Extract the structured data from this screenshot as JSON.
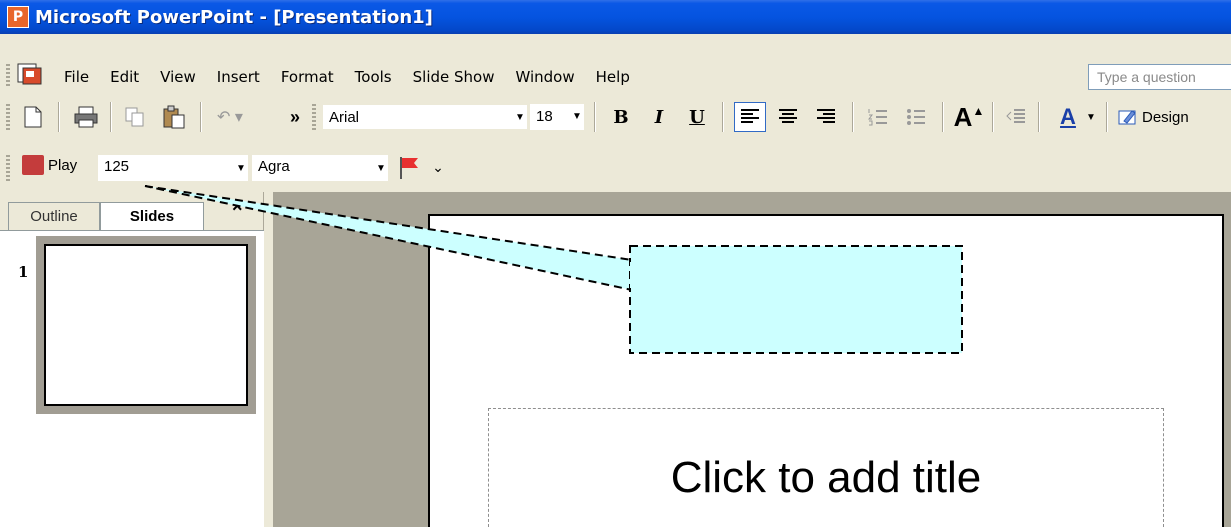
{
  "window": {
    "title": "Microsoft PowerPoint - [Presentation1]"
  },
  "menu": {
    "items": [
      "File",
      "Edit",
      "View",
      "Insert",
      "Format",
      "Tools",
      "Slide Show",
      "Window",
      "Help"
    ],
    "help_placeholder": "Type a question"
  },
  "formatting": {
    "font": "Arial",
    "size": "18",
    "bold": "B",
    "italic": "I",
    "underline": "U",
    "grow_font": "A",
    "font_color": "A",
    "design": "Design",
    "more": "»"
  },
  "narration": {
    "play_label": "Play",
    "value": "125",
    "voice": "Agra"
  },
  "pane": {
    "tab_outline": "Outline",
    "tab_slides": "Slides",
    "close": "×",
    "slide_number": "1"
  },
  "slide": {
    "title_placeholder": "Click to add title"
  },
  "colors": {
    "title_bar": "#0554E0",
    "callout_fill": "#CCFFFF",
    "app_icon": "#E8662A"
  }
}
